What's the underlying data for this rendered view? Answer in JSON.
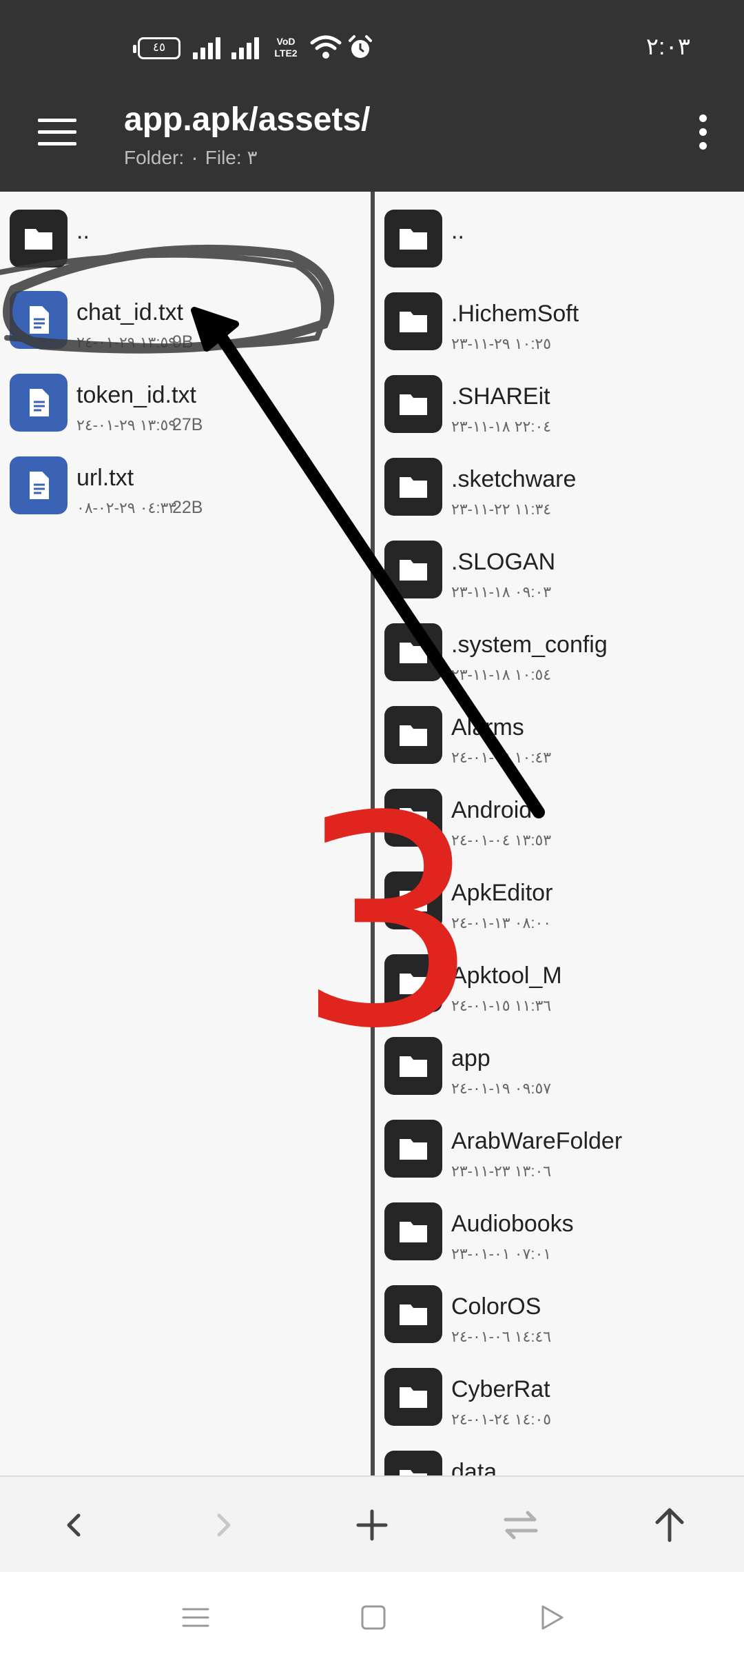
{
  "status_bar": {
    "battery": "٤٥",
    "network_badge": "VoD LTE2",
    "time": "٢:٠٣"
  },
  "header": {
    "title": "app.apk/assets/",
    "subtitle": "Folder: ٠  File: ٣"
  },
  "left_pane": {
    "items": [
      {
        "name": "..",
        "type": "folder",
        "meta": "",
        "size": ""
      },
      {
        "name": "chat_id.txt",
        "type": "file",
        "meta": "١٣:٥٩ ٢٩-٠١-٢٤",
        "size": "9B"
      },
      {
        "name": "token_id.txt",
        "type": "file",
        "meta": "١٣:٥٩ ٢٩-٠١-٢٤",
        "size": "27B"
      },
      {
        "name": "url.txt",
        "type": "file",
        "meta": "٠٤:٣٣ ٢٩-٠٢-٠٨",
        "size": "22B"
      }
    ]
  },
  "right_pane": {
    "items": [
      {
        "name": "..",
        "meta": ""
      },
      {
        "name": ".HichemSoft",
        "meta": "١٠:٢٥ ٢٩-١١-٢٣"
      },
      {
        "name": ".SHAREit",
        "meta": "٢٢:٠٤ ١٨-١١-٢٣"
      },
      {
        "name": ".sketchware",
        "meta": "١١:٣٤ ٢٢-١١-٢٣"
      },
      {
        "name": ".SLOGAN",
        "meta": "٠٩:٠٣ ١٨-١١-٢٣"
      },
      {
        "name": ".system_config",
        "meta": "١٠:٥٤ ١٨-١١-٢٣"
      },
      {
        "name": "Alarms",
        "meta": "١٠:٤٣ ٠٩-٠١-٢٤"
      },
      {
        "name": "Android",
        "meta": "١٣:٥٣ ٠٤-٠١-٢٤"
      },
      {
        "name": "ApkEditor",
        "meta": "٠٨:٠٠ ١٣-٠١-٢٤"
      },
      {
        "name": "Apktool_M",
        "meta": "١١:٣٦ ١٥-٠١-٢٤"
      },
      {
        "name": "app",
        "meta": "٠٩:٥٧ ١٩-٠١-٢٤"
      },
      {
        "name": "ArabWareFolder",
        "meta": "١٣:٠٦ ٢٣-١١-٢٣"
      },
      {
        "name": "Audiobooks",
        "meta": "٠٧:٠١ ٠١-٠١-٢٣"
      },
      {
        "name": "ColorOS",
        "meta": "١٤:٤٦ ٠٦-٠١-٢٤"
      },
      {
        "name": "CyberRat",
        "meta": "١٤:٠٥ ٢٤-٠١-٢٤"
      },
      {
        "name": "data",
        "meta": ""
      }
    ]
  },
  "annotation": {
    "number": "3",
    "color": "#e0251e",
    "arrow_color": "#000000"
  },
  "colors": {
    "toolbar_bg": "#333333",
    "file_icon": "#3b63b5",
    "folder_icon": "#262626",
    "pane_bg": "#f7f7f7"
  }
}
